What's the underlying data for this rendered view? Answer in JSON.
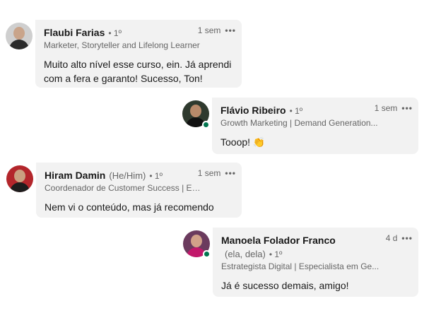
{
  "comments": [
    {
      "name": "Flaubi Farias",
      "pronouns": "",
      "degree": "• 1º",
      "headline": "Marketer, Storyteller and Lifelong Learner",
      "time": "1 sem",
      "text": "Muito alto nível esse curso, ein. Já aprendi com a fera e garanto! Sucesso, Ton!",
      "avatar_colors": {
        "bg": "#cfcfcf",
        "skin": "#c9a48a",
        "shirt": "#2b2b2b"
      }
    },
    {
      "name": "Flávio Ribeiro",
      "pronouns": "",
      "degree": "• 1º",
      "headline": "Growth Marketing | Demand Generation...",
      "time": "1 sem",
      "text": "Tooop! 👏",
      "avatar_colors": {
        "bg": "#2f3a2e",
        "skin": "#b88a6a",
        "shirt": "#111111"
      }
    },
    {
      "name": "Hiram Damin",
      "pronouns": "(He/Him)",
      "degree": "• 1º",
      "headline": "Coordenador de Customer Success | Es...",
      "time": "1 sem",
      "text": "Nem vi o conteúdo, mas já recomendo",
      "avatar_colors": {
        "bg": "#b3262b",
        "skin": "#caa080",
        "shirt": "#1d1d1d"
      }
    },
    {
      "name": "Manoela Folador Franco",
      "pronouns": "(ela, dela)",
      "degree": "• 1º",
      "headline": "Estrategista Digital | Especialista em Ge...",
      "time": "4 d",
      "text": "Já é sucesso demais, amigo!",
      "avatar_colors": {
        "bg": "#6b3b5e",
        "skin": "#d2a189",
        "shirt": "#c2186b"
      }
    }
  ],
  "ui": {
    "more_icon": "•••"
  },
  "colors": {
    "bubble": "#f2f2f2",
    "online": "#01754f",
    "muted": "#666666"
  }
}
